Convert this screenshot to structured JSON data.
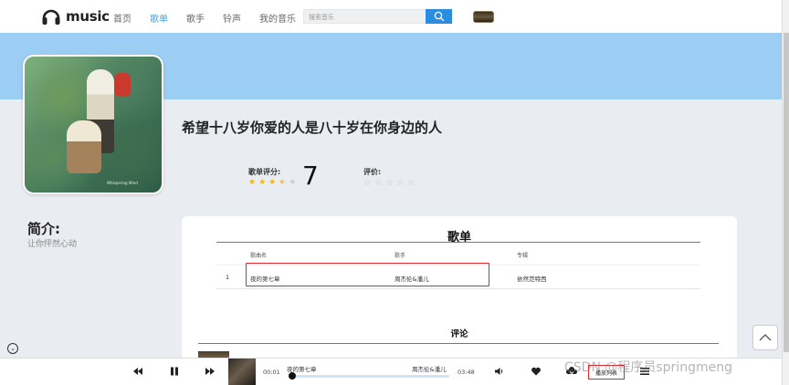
{
  "app": {
    "logo_text": "music"
  },
  "nav": {
    "items": [
      {
        "label": "首页",
        "active": false
      },
      {
        "label": "歌单",
        "active": true
      },
      {
        "label": "歌手",
        "active": false
      },
      {
        "label": "铃声",
        "active": false
      },
      {
        "label": "我的音乐",
        "active": false
      }
    ]
  },
  "search": {
    "placeholder": "搜索音乐",
    "button_icon": "search-icon"
  },
  "playlist": {
    "title": "希望十八岁你爱的人是八十岁在你身边的人",
    "rating_label": "歌单评分:",
    "rating_score": "7",
    "rating_stars": 3.5,
    "rating_stars_max": 5,
    "eval_label": "评价:",
    "eval_stars": 0,
    "cover_signature": "Whispering Wind"
  },
  "intro": {
    "heading": "简介:",
    "text": "让你怦然心动"
  },
  "song_list": {
    "title": "歌单",
    "columns": [
      "歌曲名",
      "歌手",
      "专辑"
    ],
    "rows": [
      {
        "index": "1",
        "name": "夜的第七章",
        "artist": "周杰伦&潘儿",
        "album": "依然范特西"
      }
    ]
  },
  "comments": {
    "title": "评论"
  },
  "player": {
    "current_time": "00:01",
    "total_time": "03:48",
    "song_name": "夜的第七章",
    "artist": "周杰伦&潘儿",
    "progress": 0.02,
    "playlist_button": "播放列表"
  },
  "watermark": "CSDN @程序员springmeng",
  "colors": {
    "accent": "#2b8de0",
    "banner": "#9ccdf2",
    "highlight_box": "#e0262b",
    "star": "#f3b326"
  }
}
